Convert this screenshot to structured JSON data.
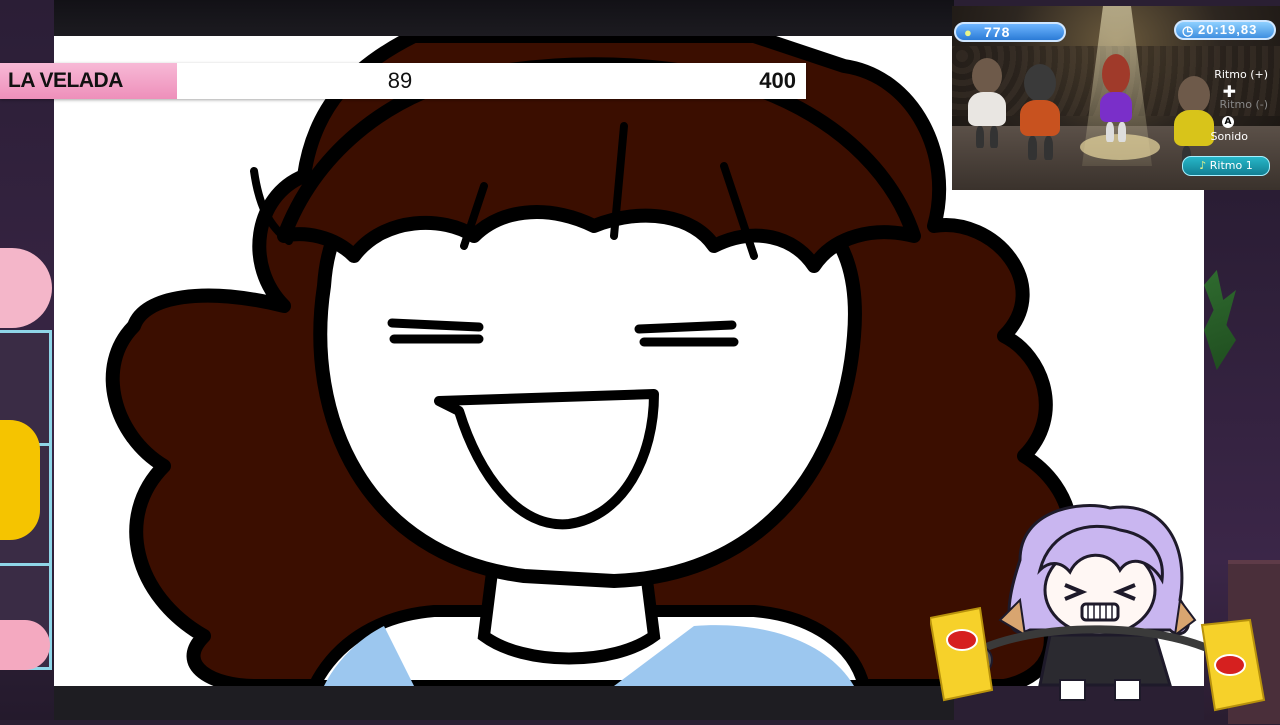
{
  "scoreboard": {
    "label": "LA VELADA",
    "current": "89",
    "goal": "400"
  },
  "game_hud": {
    "score": "778",
    "timer": "20:19,83",
    "controls": {
      "plus_label": "Ritmo (+)",
      "minus_label": "Ritmo (-)",
      "a_button_glyph": "A",
      "a_label": "Sonido",
      "selected_rhythm": "Ritmo 1"
    }
  },
  "avatar": {
    "snack_brand": "lay's"
  },
  "colors": {
    "scoreboard_accent": "#ee8fba",
    "hair": "#3b0e00",
    "hud_blue": "#2b7bd6",
    "hud_teal": "#127f93",
    "avatar_hair": "#c9b6f0",
    "chips_bag": "#f6d12a"
  }
}
